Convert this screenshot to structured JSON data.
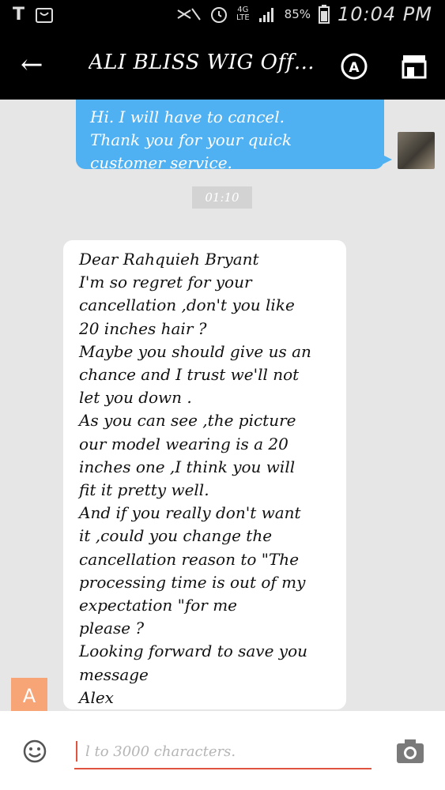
{
  "status_bar": {
    "carrier_icon": "t-mobile-icon",
    "icons": [
      "gallery-icon",
      "mute-icon",
      "alarm-icon",
      "network-4g-lte-icon",
      "signal-icon"
    ],
    "battery": "85%",
    "time": "10:04 PM"
  },
  "header": {
    "title": "ALI BLISS WIG Offici...",
    "back_icon": "back-arrow-icon",
    "translate_icon": "translate-icon",
    "store_icon": "store-icon"
  },
  "messages": {
    "outgoing": {
      "lines": [
        "Hi. I will have to cancel.",
        "Thank you for your quick",
        "customer service."
      ]
    },
    "timestamp": "01:10",
    "incoming": {
      "sender_initial": "A",
      "lines": [
        "Dear Rahquieh Bryant",
        "I'm so regret for your",
        "cancellation ,don't you like",
        "20 inches hair ?",
        "Maybe you should give us an",
        "chance and I trust we'll not",
        "let you down .",
        "As you can see ,the picture",
        "our model wearing is a 20",
        "inches one ,I think you will",
        "fit it pretty well.",
        "And if you really don't want",
        "it ,could you change the",
        "cancellation reason to \"The",
        "processing time is out of my",
        "expectation \"for me",
        "please ?",
        "Looking forward to save you",
        "message",
        "Alex"
      ]
    }
  },
  "input": {
    "placeholder": "l to 3000 characters.",
    "emoji_icon": "emoji-icon",
    "camera_icon": "camera-icon"
  },
  "colors": {
    "outgoing_bubble": "#4fb1f2",
    "header_bg": "#000000",
    "accent": "#e0533f",
    "sender_avatar": "#f7a477"
  }
}
